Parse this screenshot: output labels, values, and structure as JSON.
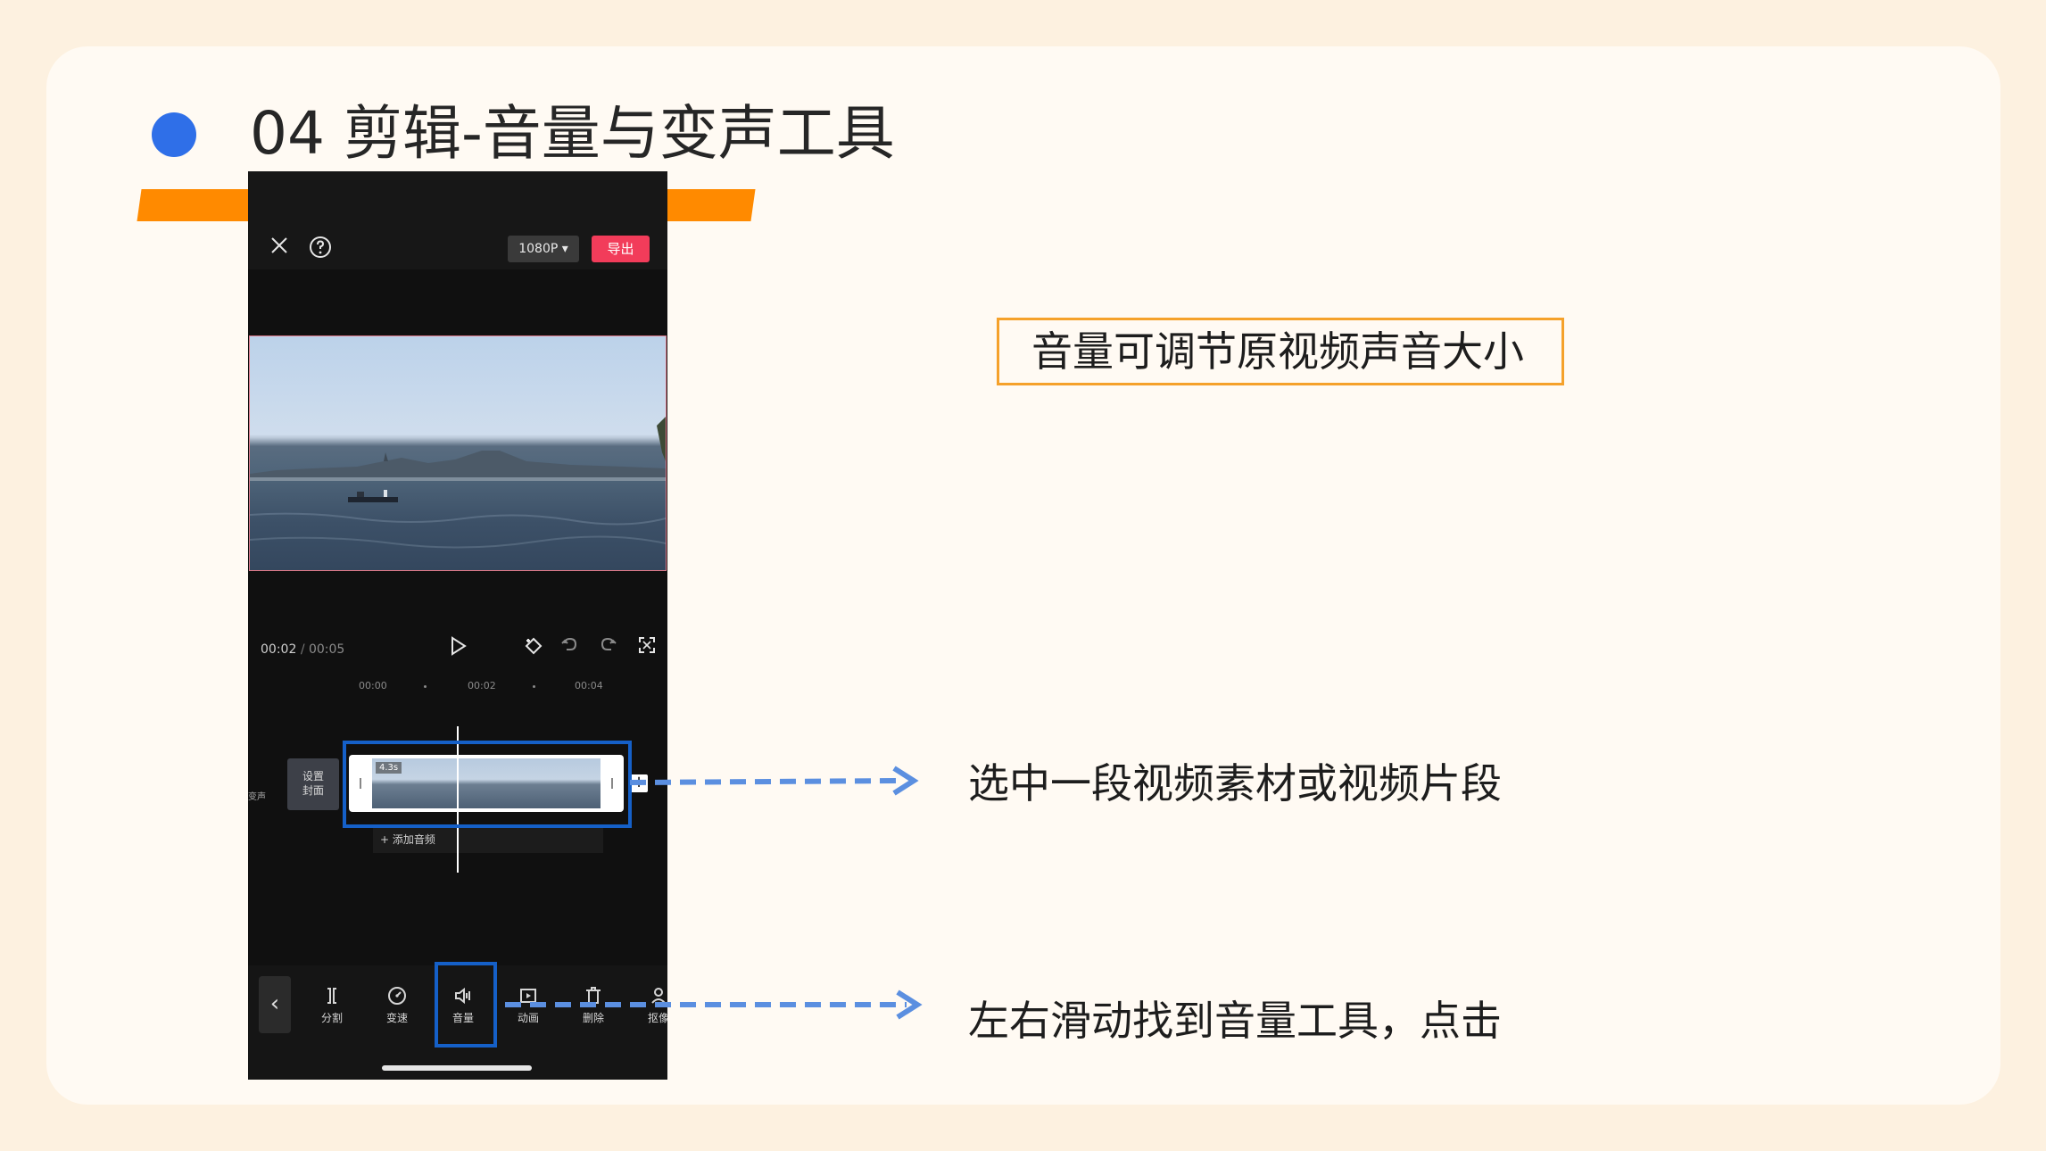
{
  "title": "04 剪辑-音量与变声工具",
  "colors": {
    "accent_blue": "#2f6fe8",
    "accent_orange": "#ff8a00",
    "highlight_blue": "#1560c8",
    "export_red": "#f23c5a"
  },
  "phone": {
    "resolution_label": "1080P ▾",
    "export_label": "导出",
    "time_current": "00:02",
    "time_separator": "/",
    "time_total": "00:05",
    "ruler": [
      "00:00",
      "00:02",
      "00:04"
    ],
    "cover_label_1": "设置",
    "cover_label_2": "封面",
    "side_label": "变声",
    "clip_duration": "4.3s",
    "add_audio_label": "+ 添加音频",
    "back_glyph": "‹",
    "tools": [
      {
        "label": "分割",
        "icon": "split-icon"
      },
      {
        "label": "变速",
        "icon": "speed-icon"
      },
      {
        "label": "音量",
        "icon": "volume-icon"
      },
      {
        "label": "动画",
        "icon": "animation-icon"
      },
      {
        "label": "删除",
        "icon": "delete-icon"
      },
      {
        "label": "抠像",
        "icon": "cutout-icon"
      }
    ]
  },
  "annotations": {
    "volume_note": "音量可调节原视频声音大小",
    "select_note": "选中一段视频素材或视频片段",
    "slide_note": "左右滑动找到音量工具，点击"
  }
}
